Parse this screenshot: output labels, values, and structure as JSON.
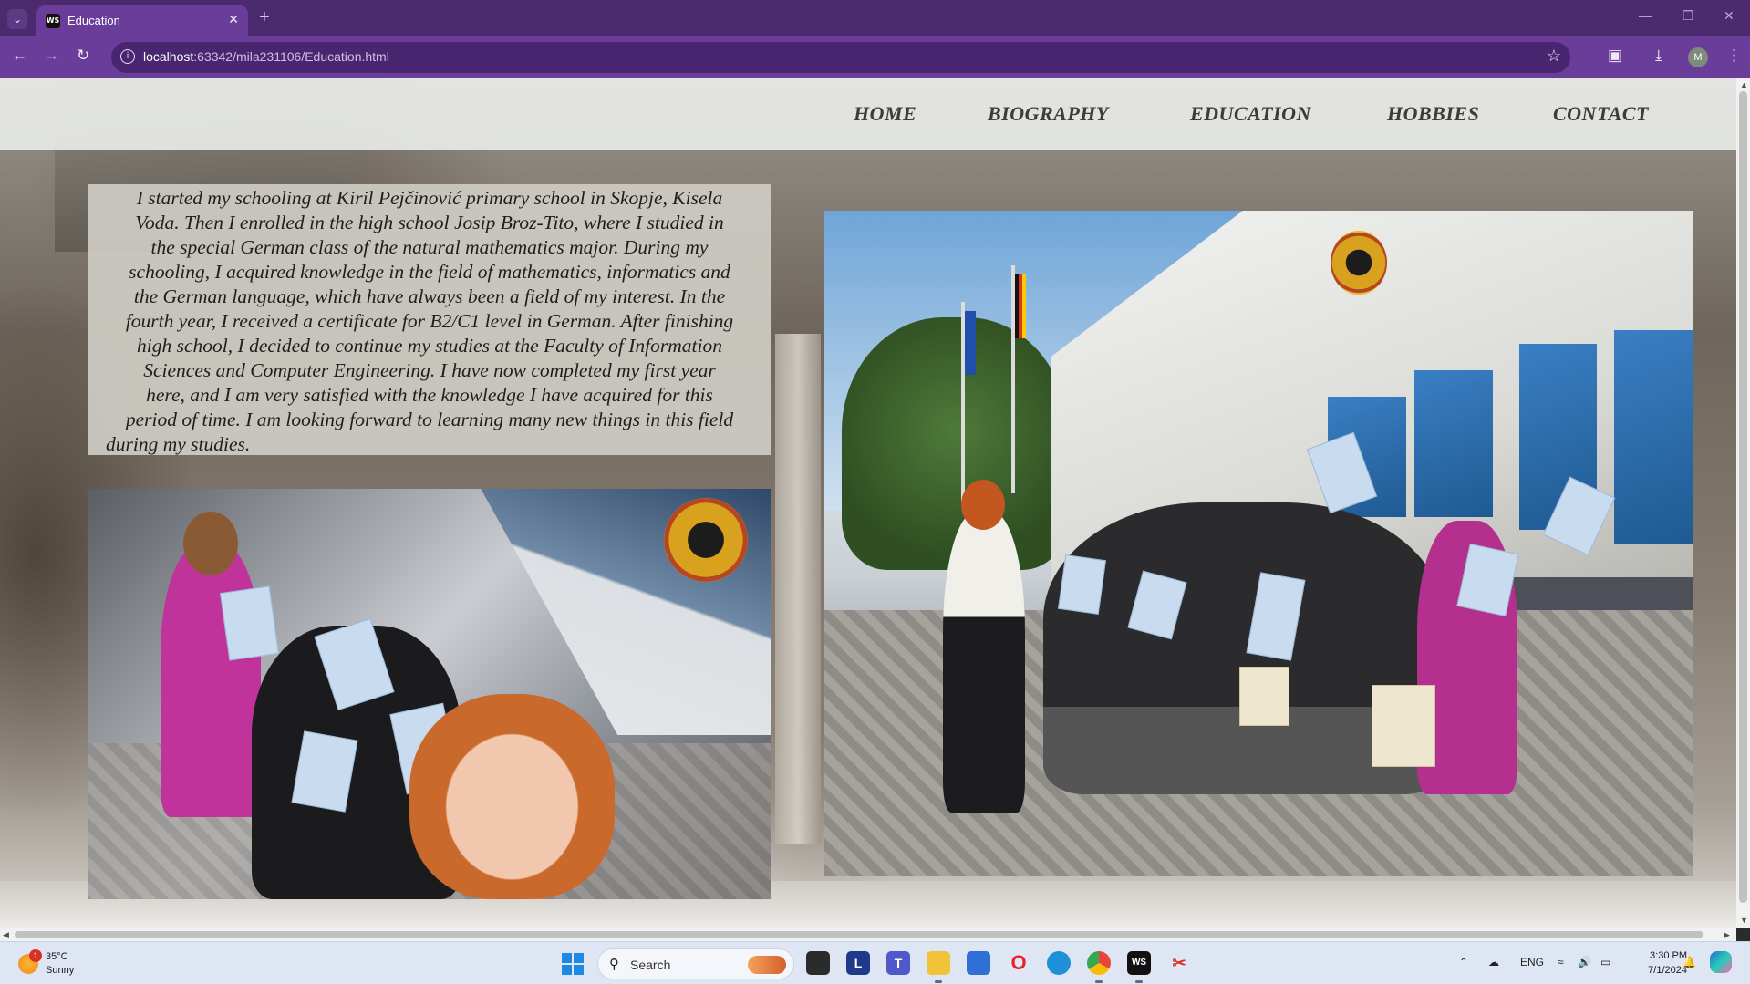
{
  "browser": {
    "tab_title": "Education",
    "tab_favicon": "WS",
    "url_host": "localhost",
    "url_rest": ":63342/mila231106/Education.html",
    "profile_initial": "M"
  },
  "nav": {
    "items": [
      "HOME",
      "BIOGRAPHY",
      "EDUCATION",
      "HOBBIES",
      "CONTACT"
    ]
  },
  "content": {
    "intro_lines": [
      "I started my schooling at Kiril Pejčinović primary school in Skopje, Kisela",
      "Voda. Then I enrolled in the high school Josip Broz-Tito, where I studied in",
      "the special German class of the natural mathematics major. During my",
      "schooling, I acquired knowledge in the field of mathematics, informatics and",
      "the German language, which have always been a field of my interest. In the",
      "fourth year, I received a certificate for B2/C1 level in German. After finishing",
      "high school, I decided to continue my studies at the Faculty of Information",
      "Sciences and Computer Engineering. I have now completed my first year",
      "here, and I am very satisfied with the knowledge I have acquired for this",
      "period of time. I am looking forward to learning many new things in this field",
      "during my studies."
    ]
  },
  "taskbar": {
    "weather_temp": "35°C",
    "weather_condition": "Sunny",
    "weather_badge": "1",
    "search_placeholder": "Search",
    "tray_language": "ENG",
    "clock_time": "3:30 PM",
    "clock_date": "7/1/2024"
  },
  "colors": {
    "browser_frame": "#4b2a6e",
    "toolbar": "#6a3d9a",
    "nav_text": "#3c3c3c"
  }
}
